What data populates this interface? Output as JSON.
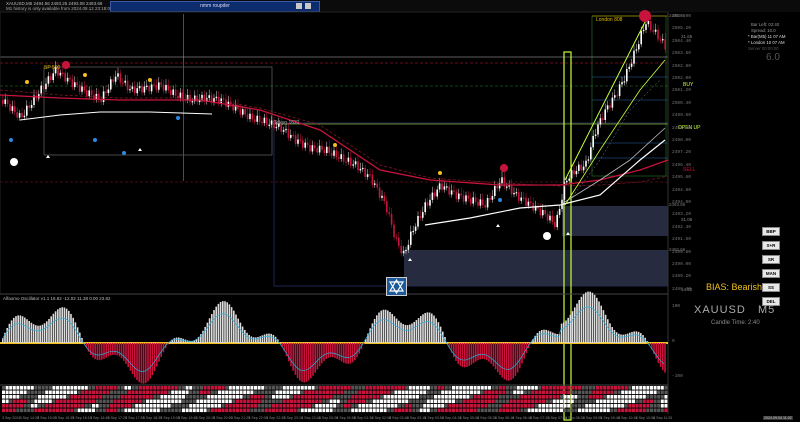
{
  "window": {
    "symbol_line": "XAUUSD,M5  2494.56 2493.25 2493.08 2493.68",
    "history_note": "M1 history is only available from 2024.08.12 23:18:00",
    "tab_title": "nmm roupder"
  },
  "levels": {
    "london_label": "London 808",
    "sp_label": "SP 500",
    "tokyo_label": "Tokyo 1622",
    "buy_label": "BUY",
    "open_up_label": "OPEN UP",
    "sell_label": "SELL",
    "level_2493_85": "2493.85",
    "level_2492_66": "2492.66",
    "level_2491_86": "2491.86",
    "pct_a": "21.65",
    "pct_b": "31.05",
    "pct_c": "14.22"
  },
  "price_axis": [
    "2506.00",
    "2505.20",
    "2504.40",
    "2503.60",
    "2502.80",
    "2502.00",
    "2501.20",
    "2500.40",
    "2499.60",
    "2498.80",
    "2498.00",
    "2497.20",
    "2496.40",
    "2495.60",
    "2494.80",
    "2494.00",
    "2493.20",
    "2492.40",
    "2491.60",
    "2490.80",
    "2490.00",
    "2489.20",
    "2488.40"
  ],
  "dashboard": {
    "line1": "Bar Left: 02:40",
    "line2": "Spread: 10.0",
    "line3": "* Bar(M5) 11 07 AM",
    "line4": "* London 10 07 AM",
    "line5": "Server 00:00:00",
    "big_value": "6.0"
  },
  "side_buttons": [
    "BBP",
    "S+R",
    "SR",
    "MAN",
    "SS",
    "DEL"
  ],
  "bias_text": "BIAS: Bearish",
  "oscillator_label": "Alfaomo Oscillator  v1.1  16.82  -12.02  11.38  0.00  23.82",
  "instrument": "XAUUSD",
  "timeframe": "M5",
  "candle_time": "Candle Time: 2:40",
  "osc_axis": [
    "100",
    "0",
    "-100"
  ],
  "time_axis": [
    "3 Sep 2024",
    "3 Sep 14:25",
    "3 Sep 15:00",
    "3 Sep 15:35",
    "3 Sep 16:10",
    "3 Sep 16:45",
    "3 Sep 17:20",
    "3 Sep 17:55",
    "3 Sep 18:30",
    "3 Sep 19:05",
    "3 Sep 19:40",
    "3 Sep 20:15",
    "3 Sep 20:50",
    "3 Sep 21:25",
    "3 Sep 22:00",
    "3 Sep 22:35",
    "3 Sep 23:10",
    "3 Sep 23:45",
    "4 Sep 00:20",
    "4 Sep 00:55",
    "4 Sep 01:30",
    "4 Sep 02:05",
    "4 Sep 02:40",
    "4 Sep 03:15",
    "4 Sep 03:50",
    "4 Sep 04:25",
    "4 Sep 05:00",
    "4 Sep 05:35",
    "4 Sep 06:10",
    "4 Sep 06:45",
    "4 Sep 07:20",
    "4 Sep 07:55",
    "4 Sep 08:30",
    "4 Sep 09:05",
    "4 Sep 09:40",
    "4 Sep 10:15",
    "4 Sep 10:50",
    "4 Sep 11:25"
  ],
  "time_marker": "2024.09.04 11:02",
  "colors": {
    "bull": "#ffffff",
    "bear": "#c8143c",
    "lime": "#c8ff3c",
    "bluebox": "#3a4a70",
    "accent": "#f0c020"
  }
}
